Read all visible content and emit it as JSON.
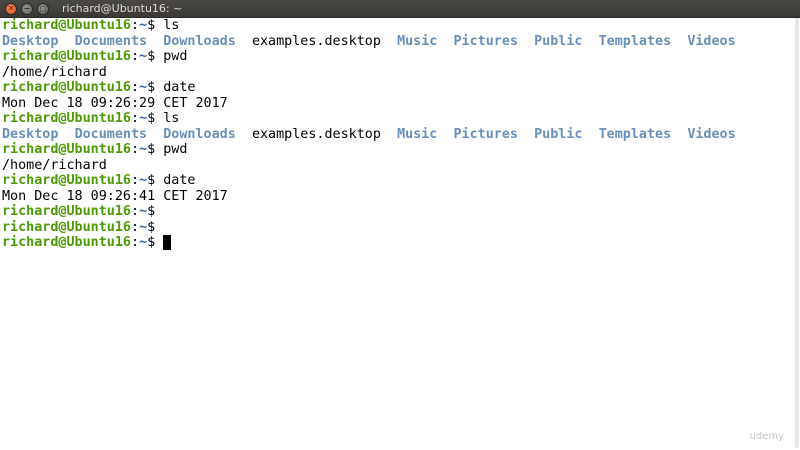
{
  "window": {
    "title": "richard@Ubuntu16: ~",
    "close_glyph": "✕",
    "minimize_glyph": "−",
    "maximize_glyph": "□"
  },
  "prompt": {
    "user": "richard@Ubuntu16",
    "sep": ":",
    "path": "~",
    "symbol": "$ "
  },
  "terminal": {
    "lines": [
      {
        "type": "prompt",
        "cmd": "ls"
      },
      {
        "type": "ls",
        "entries": [
          {
            "name": "Desktop",
            "dir": true
          },
          {
            "name": "Documents",
            "dir": true
          },
          {
            "name": "Downloads",
            "dir": true
          },
          {
            "name": "examples.desktop",
            "dir": false
          },
          {
            "name": "Music",
            "dir": true
          },
          {
            "name": "Pictures",
            "dir": true
          },
          {
            "name": "Public",
            "dir": true
          },
          {
            "name": "Templates",
            "dir": true
          },
          {
            "name": "Videos",
            "dir": true
          }
        ]
      },
      {
        "type": "prompt",
        "cmd": "pwd"
      },
      {
        "type": "output",
        "text": "/home/richard"
      },
      {
        "type": "prompt",
        "cmd": "date"
      },
      {
        "type": "output",
        "text": "Mon Dec 18 09:26:29 CET 2017"
      },
      {
        "type": "prompt",
        "cmd": "ls"
      },
      {
        "type": "ls",
        "entries": [
          {
            "name": "Desktop",
            "dir": true
          },
          {
            "name": "Documents",
            "dir": true
          },
          {
            "name": "Downloads",
            "dir": true
          },
          {
            "name": "examples.desktop",
            "dir": false
          },
          {
            "name": "Music",
            "dir": true
          },
          {
            "name": "Pictures",
            "dir": true
          },
          {
            "name": "Public",
            "dir": true
          },
          {
            "name": "Templates",
            "dir": true
          },
          {
            "name": "Videos",
            "dir": true
          }
        ]
      },
      {
        "type": "prompt",
        "cmd": "pwd"
      },
      {
        "type": "output",
        "text": "/home/richard"
      },
      {
        "type": "prompt",
        "cmd": "date"
      },
      {
        "type": "output",
        "text": "Mon Dec 18 09:26:41 CET 2017"
      },
      {
        "type": "prompt",
        "cmd": ""
      },
      {
        "type": "prompt",
        "cmd": ""
      },
      {
        "type": "prompt",
        "cmd": "",
        "cursor": true
      }
    ]
  },
  "colors": {
    "prompt_user": "#4e9a06",
    "prompt_path": "#3465a4",
    "directory": "#6a8fb9",
    "text": "#000000",
    "background": "#ffffff"
  },
  "watermark": "udemy"
}
